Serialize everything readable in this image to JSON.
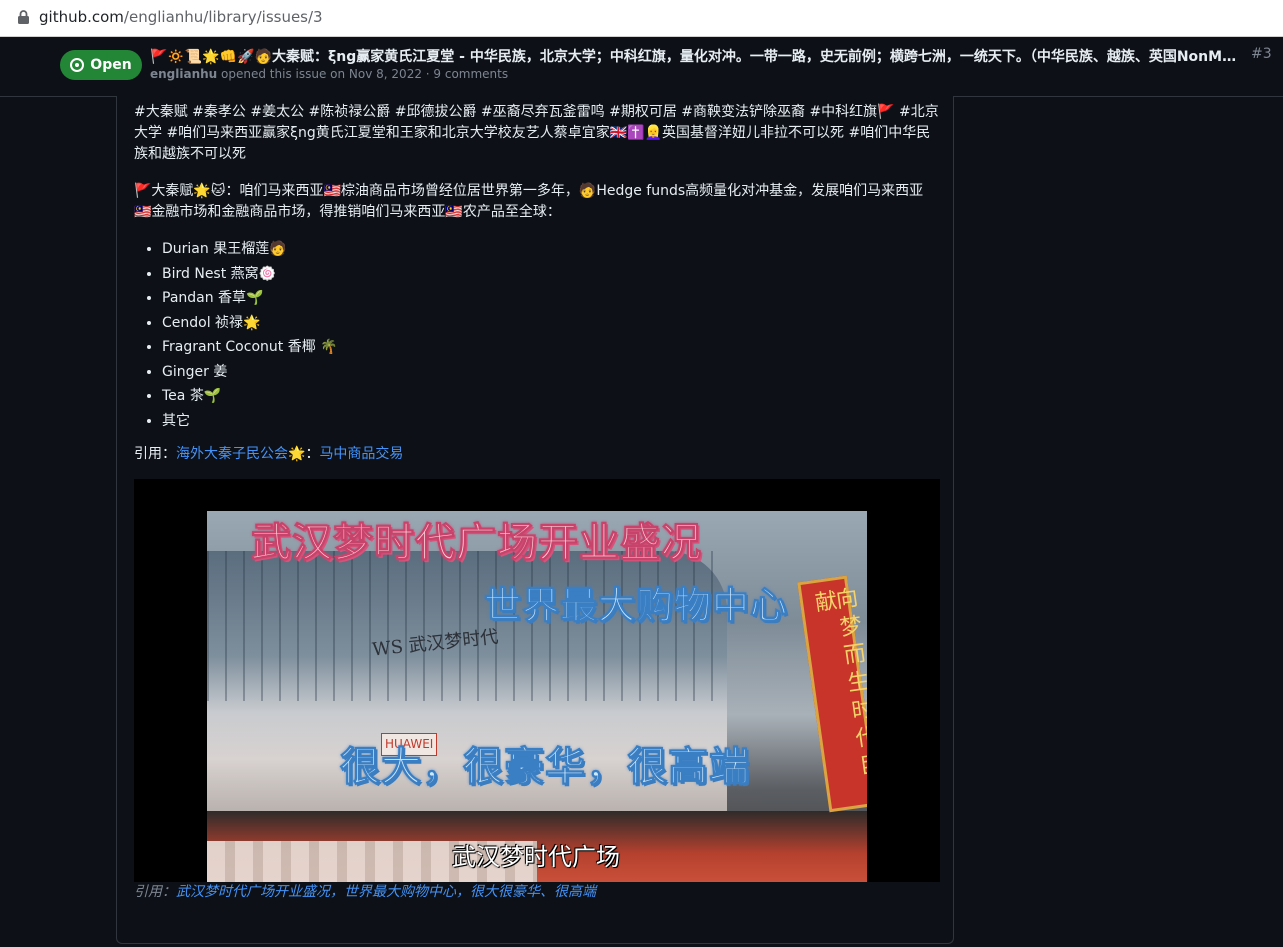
{
  "browser": {
    "url_host": "github.com",
    "url_path": "/englianhu/library/issues/3"
  },
  "issue": {
    "state": "Open",
    "title": "🚩🔅📜🌟👊🚀🧑大秦赋：ξng赢家黄氏江夏堂 - 中华民族，北京大学；中科红旗，量化对冲。一带一路，史无前例；横跨七洲，一统天下。（中华民族、越族、英国NonMuslim…",
    "number": "#3",
    "author": "englianhu",
    "meta_text": " opened this issue on Nov 8, 2022 · 9 comments"
  },
  "body": {
    "hashtags": "#大秦赋 #秦孝公 #姜太公 #陈祯禄公爵 #邱德拔公爵 #巫裔尽弃瓦釜雷鸣 #期权可居 #商鞅变法铲除巫裔 #中科红旗🚩 #北京大学 #咱们马来西亚赢家ξng黄氏江夏堂和王家和北京大学校友艺人蔡卓宜家🇬🇧✝️👱‍♀️英国基督洋妞儿非拉不可以死 #咱们中华民族和越族不可以死",
    "intro": "🚩大秦赋🌟🐱：咱们马来西亚🇲🇾棕油商品市场曾经位居世界第一多年，🧑Hedge funds高频量化对冲基金，发展咱们马来西亚🇲🇾金融市场和金融商品市场，得推销咱们马来西亚🇲🇾农产品至全球：",
    "products": [
      "Durian 果王榴莲🧑",
      "Bird Nest 燕窝🍥",
      "Pandan 香草🌱",
      "Cendol 祯禄🌟",
      "Fragrant Coconut 香椰 🌴",
      "Ginger 姜",
      "Tea 茶🌱",
      "其它"
    ],
    "cite_prefix": "引用：",
    "cite_link1": "海外大秦子民公会🌟",
    "cite_sep": "：",
    "cite_link2": "马中商品交易",
    "video": {
      "overlay_title": "武汉梦时代广场开业盛况",
      "overlay_sub": "世界最大购物中心",
      "overlay_bottom": "很大，很豪华，很高端",
      "subtitle": "武汉梦时代广场",
      "banner": "向梦而生时代巨献",
      "sign": "WS 武汉梦时代",
      "store": "HUAWEI"
    },
    "caption_prefix": "引用：",
    "caption_link": "武汉梦时代广场开业盛况，世界最大购物中心，很大很豪华、很高端"
  }
}
